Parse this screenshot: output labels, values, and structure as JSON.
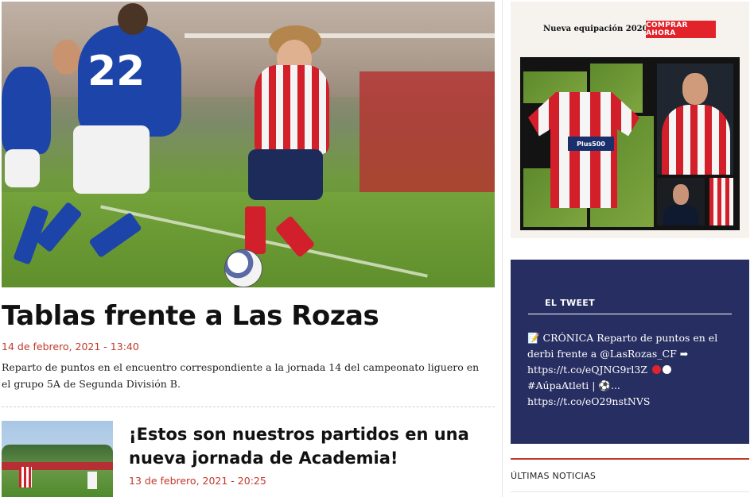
{
  "main": {
    "hero_jersey_number": "22",
    "lead": {
      "title": "Tablas frente a Las Rozas",
      "date": "14 de febrero, 2021 - 13:40",
      "excerpt": "Reparto de puntos en el encuentro correspondiente a la jornada 14 del campeonato liguero en el grupo 5A de Segunda División B."
    },
    "second": {
      "title": "¡Estos son nuestros partidos en una nueva jornada de Academia!",
      "date": "13 de febrero, 2021 - 20:25"
    }
  },
  "sidebar": {
    "ad": {
      "text": "Nueva equipación 2020/21",
      "button": "COMPRAR AHORA",
      "kit_sponsor": "Plus500"
    },
    "tweet": {
      "heading": "EL TWEET",
      "line1": "📝 CRÓNICA Reparto de puntos en el derbi frente a @LasRozas_CF ➡",
      "line2": "https://t.co/eQJNG9rl3Z",
      "line3": "#AúpaAtleti | ⚽...",
      "line4": "https://t.co/eO29nstNVS"
    },
    "latest_news": {
      "heading": "ÚLTIMAS NOTICIAS"
    }
  },
  "colors": {
    "accent_red": "#c0392b",
    "button_red": "#e2232c",
    "tweet_bg": "#272e61"
  }
}
